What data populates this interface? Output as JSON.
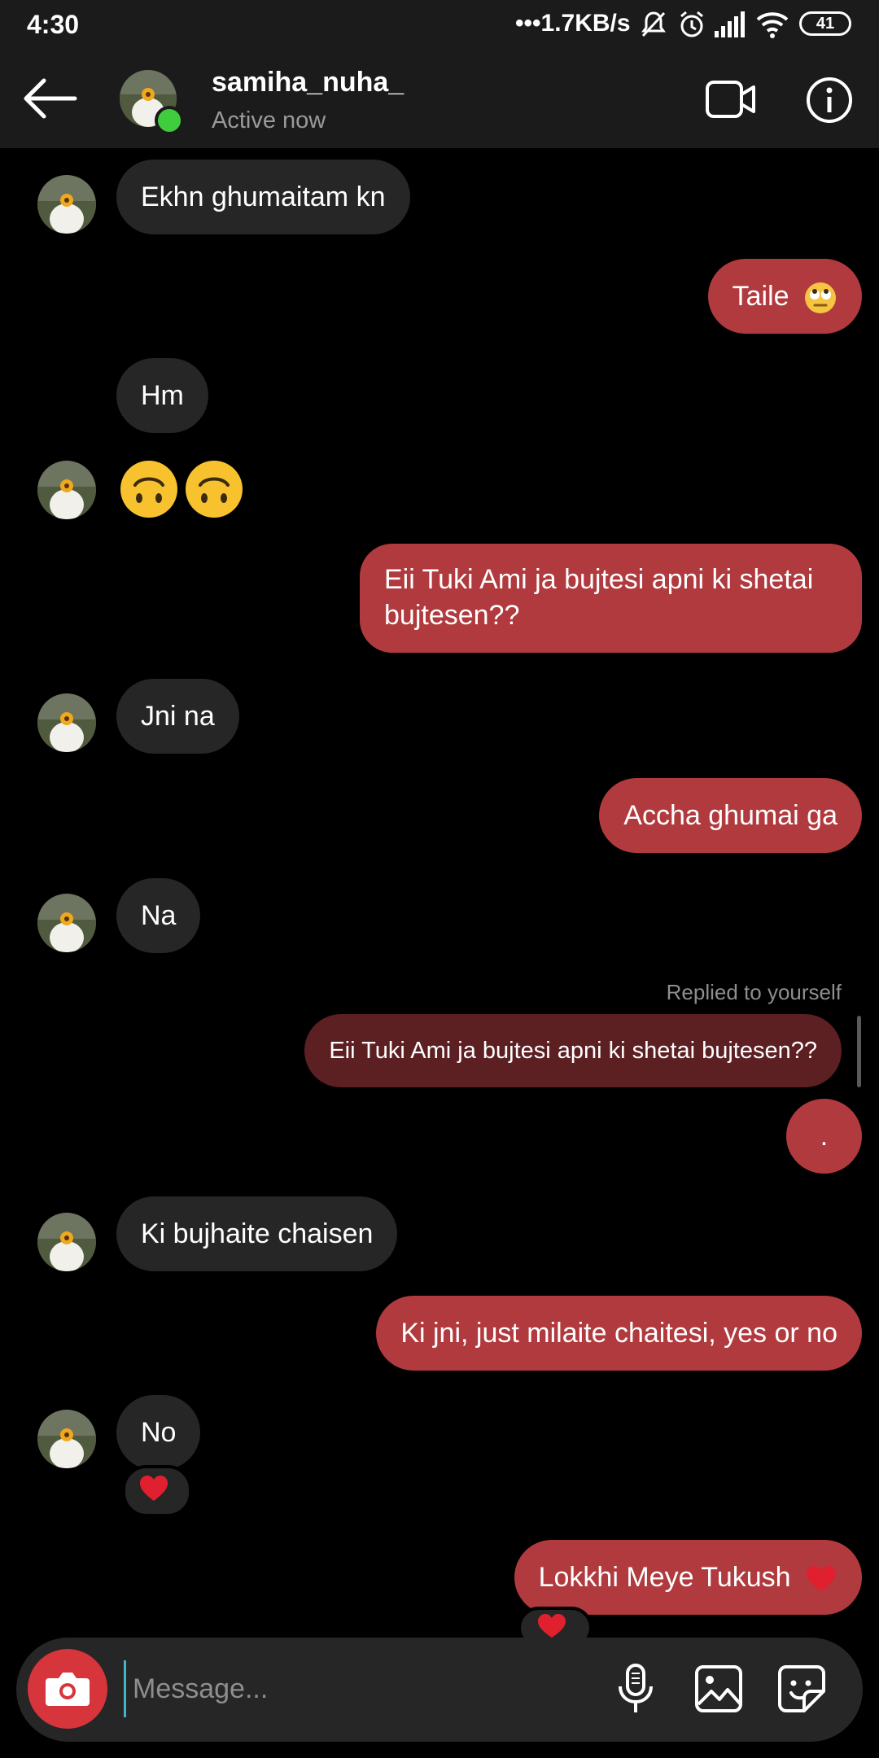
{
  "status_bar": {
    "time": "4:30",
    "network_speed": "•••1.7KB/s",
    "battery": "41"
  },
  "header": {
    "contact_name": "samiha_nuha_",
    "contact_status": "Active now"
  },
  "messages": [
    {
      "side": "in",
      "text": "Ekhn ghumaitam kn",
      "avatar": true
    },
    {
      "side": "out",
      "text": "Taile",
      "emoji": "eye-roll"
    },
    {
      "side": "in",
      "text": "Hm",
      "avatar": false
    },
    {
      "side": "in",
      "text": "🙃🙃",
      "avatar": true,
      "emoji_only": true
    },
    {
      "side": "out",
      "text": "Eii Tuki Ami ja bujtesi apni ki shetai bujtesen??"
    },
    {
      "side": "in",
      "text": "Jni na",
      "avatar": true
    },
    {
      "side": "out",
      "text": "Accha ghumai ga"
    },
    {
      "side": "in",
      "text": "Na",
      "avatar": true
    },
    {
      "side": "out",
      "reply_label": "Replied to yourself",
      "quoted_text": "Eii Tuki Ami ja bujtesi apni ki shetai bujtesen??",
      "text": "."
    },
    {
      "side": "in",
      "text": "Ki bujhaite chaisen",
      "avatar": true
    },
    {
      "side": "out",
      "text": "Ki jni, just milaite chaitesi, yes or no"
    },
    {
      "side": "in",
      "text": "No",
      "avatar": true,
      "reaction": "❤️"
    },
    {
      "side": "out",
      "text": "Lokkhi Meye Tukush",
      "emoji": "heart",
      "reaction": "❤️"
    }
  ],
  "composer": {
    "placeholder": "Message..."
  },
  "colors": {
    "background": "#000000",
    "bar": "#1b1b1b",
    "incoming_bubble": "#262626",
    "outgoing_bubble": "#b03a3e",
    "reply_bubble": "#5c1f22",
    "online": "#3fcc3d",
    "camera_button": "#d6353b"
  }
}
